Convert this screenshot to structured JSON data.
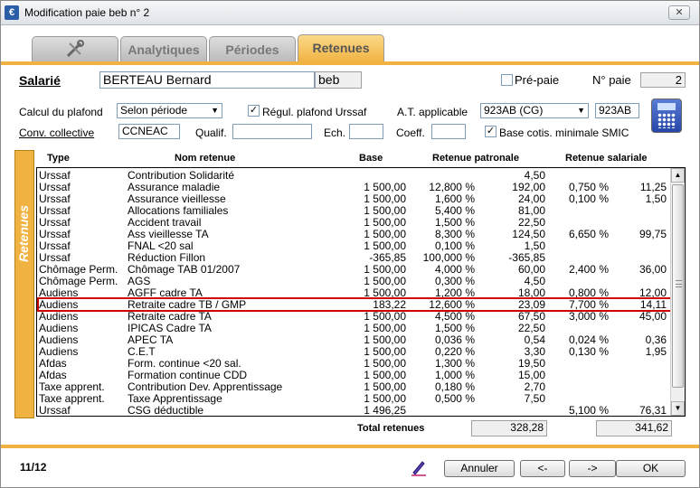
{
  "window": {
    "title": "Modification paie beb n° 2",
    "close_label": "✕",
    "app_icon": "€"
  },
  "tabs": [
    {
      "label": "",
      "icon": "tools-icon"
    },
    {
      "label": "Analytiques"
    },
    {
      "label": "Périodes"
    },
    {
      "label": "Retenues"
    }
  ],
  "header": {
    "salarie_label": "Salarié",
    "salarie_name": "BERTEAU Bernard",
    "salarie_code": "beb",
    "prepaie_label": "Pré-paie",
    "prepaie_checked": false,
    "no_paie_label": "N° paie",
    "no_paie_value": "2",
    "calcul_plafond_label": "Calcul du plafond",
    "calcul_plafond_value": "Selon période",
    "regul_label": "Régul. plafond Urssaf",
    "regul_checked": true,
    "at_label": "A.T. applicable",
    "at_value": "923AB (CG)",
    "at_code": "923AB",
    "conv_label": "Conv. collective",
    "conv_value": "CCNEAC",
    "qualif_label": "Qualif.",
    "qualif_value": "",
    "ech_label": "Ech.",
    "ech_value": "",
    "coeff_label": "Coeff.",
    "coeff_value": "",
    "base_cotis_label": "Base cotis. minimale SMIC",
    "base_cotis_checked": true
  },
  "side_label": "Retenues",
  "table": {
    "headers": {
      "type": "Type",
      "nom": "Nom retenue",
      "base": "Base",
      "patronale": "Retenue patronale",
      "salariale": "Retenue salariale"
    },
    "rows": [
      {
        "type": "Urssaf",
        "nom": "Contribution Solidarité",
        "base": "",
        "tp": "",
        "mp": "4,50",
        "ts": "",
        "ms": ""
      },
      {
        "type": "Urssaf",
        "nom": "Assurance maladie",
        "base": "1 500,00",
        "tp": "12,800 %",
        "mp": "192,00",
        "ts": "0,750 %",
        "ms": "11,25"
      },
      {
        "type": "Urssaf",
        "nom": "Assurance vieillesse",
        "base": "1 500,00",
        "tp": "1,600 %",
        "mp": "24,00",
        "ts": "0,100 %",
        "ms": "1,50"
      },
      {
        "type": "Urssaf",
        "nom": "Allocations familiales",
        "base": "1 500,00",
        "tp": "5,400 %",
        "mp": "81,00",
        "ts": "",
        "ms": ""
      },
      {
        "type": "Urssaf",
        "nom": "Accident travail",
        "base": "1 500,00",
        "tp": "1,500 %",
        "mp": "22,50",
        "ts": "",
        "ms": ""
      },
      {
        "type": "Urssaf",
        "nom": "Ass vieillesse TA",
        "base": "1 500,00",
        "tp": "8,300 %",
        "mp": "124,50",
        "ts": "6,650 %",
        "ms": "99,75"
      },
      {
        "type": "Urssaf",
        "nom": "FNAL <20 sal",
        "base": "1 500,00",
        "tp": "0,100 %",
        "mp": "1,50",
        "ts": "",
        "ms": ""
      },
      {
        "type": "Urssaf",
        "nom": "Réduction Fillon",
        "base": "-365,85",
        "tp": "100,000 %",
        "mp": "-365,85",
        "ts": "",
        "ms": ""
      },
      {
        "type": "Chômage Perm.",
        "nom": "Chômage TAB 01/2007",
        "base": "1 500,00",
        "tp": "4,000 %",
        "mp": "60,00",
        "ts": "2,400 %",
        "ms": "36,00"
      },
      {
        "type": "Chômage Perm.",
        "nom": "AGS",
        "base": "1 500,00",
        "tp": "0,300 %",
        "mp": "4,50",
        "ts": "",
        "ms": ""
      },
      {
        "type": "Audiens",
        "nom": "AGFF cadre TA",
        "base": "1 500,00",
        "tp": "1,200 %",
        "mp": "18,00",
        "ts": "0,800 %",
        "ms": "12,00"
      },
      {
        "type": "Audiens",
        "nom": "Retraite cadre TB / GMP",
        "base": "183,22",
        "tp": "12,600 %",
        "mp": "23,09",
        "ts": "7,700 %",
        "ms": "14,11"
      },
      {
        "type": "Audiens",
        "nom": "Retraite cadre TA",
        "base": "1 500,00",
        "tp": "4,500 %",
        "mp": "67,50",
        "ts": "3,000 %",
        "ms": "45,00"
      },
      {
        "type": "Audiens",
        "nom": "IPICAS Cadre TA",
        "base": "1 500,00",
        "tp": "1,500 %",
        "mp": "22,50",
        "ts": "",
        "ms": ""
      },
      {
        "type": "Audiens",
        "nom": "APEC TA",
        "base": "1 500,00",
        "tp": "0,036 %",
        "mp": "0,54",
        "ts": "0,024 %",
        "ms": "0,36"
      },
      {
        "type": "Audiens",
        "nom": "C.E.T",
        "base": "1 500,00",
        "tp": "0,220 %",
        "mp": "3,30",
        "ts": "0,130 %",
        "ms": "1,95"
      },
      {
        "type": "Afdas",
        "nom": "Form. continue <20 sal.",
        "base": "1 500,00",
        "tp": "1,300 %",
        "mp": "19,50",
        "ts": "",
        "ms": ""
      },
      {
        "type": "Afdas",
        "nom": "Formation continue CDD",
        "base": "1 500,00",
        "tp": "1,000 %",
        "mp": "15,00",
        "ts": "",
        "ms": ""
      },
      {
        "type": "Taxe apprent.",
        "nom": "Contribution Dev. Apprentissage",
        "base": "1 500,00",
        "tp": "0,180 %",
        "mp": "2,70",
        "ts": "",
        "ms": ""
      },
      {
        "type": "Taxe apprent.",
        "nom": "Taxe Apprentissage",
        "base": "1 500,00",
        "tp": "0,500 %",
        "mp": "7,50",
        "ts": "",
        "ms": ""
      },
      {
        "type": "Urssaf",
        "nom": "CSG déductible",
        "base": "1 496,25",
        "tp": "",
        "mp": "",
        "ts": "5,100 %",
        "ms": "76,31"
      }
    ],
    "selected_row": 11
  },
  "totals": {
    "label": "Total retenues",
    "patronale": "328,28",
    "salariale": "341,62"
  },
  "footer": {
    "page_indicator": "11/12",
    "annuler_label": "Annuler",
    "prev_label": "<-",
    "next_label": "->",
    "ok_label": "OK"
  }
}
